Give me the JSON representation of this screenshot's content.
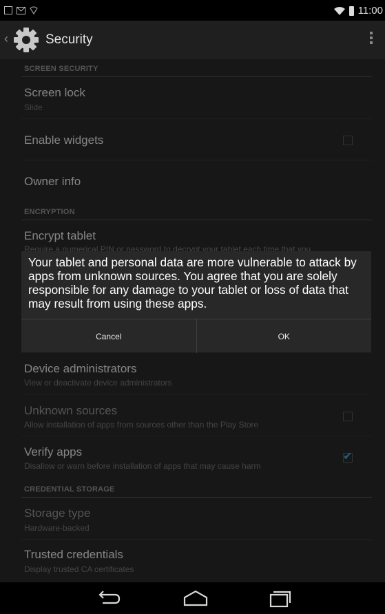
{
  "status_bar": {
    "time": "11:00",
    "icons": [
      "screenshot-icon",
      "gmail-icon",
      "notification-icon",
      "wifi-icon",
      "battery-icon"
    ]
  },
  "action_bar": {
    "title": "Security",
    "icon": "gear-icon"
  },
  "sections": {
    "screen_security": "SCREEN SECURITY",
    "encryption": "ENCRYPTION",
    "credential_storage": "CREDENTIAL STORAGE"
  },
  "items": {
    "screen_lock": {
      "title": "Screen lock",
      "summary": "Slide"
    },
    "enable_widgets": {
      "title": "Enable widgets",
      "checked": false
    },
    "owner_info": {
      "title": "Owner info"
    },
    "encrypt_tablet": {
      "title": "Encrypt tablet",
      "summary": "Require a numerical PIN or password to decrypt your tablet each time that you"
    },
    "device_admins": {
      "title": "Device administrators",
      "summary": "View or deactivate device administrators"
    },
    "unknown_sources": {
      "title": "Unknown sources",
      "summary": "Allow installation of apps from sources other than the Play Store",
      "checked": false
    },
    "verify_apps": {
      "title": "Verify apps",
      "summary": "Disallow or warn before installation of apps that may cause harm",
      "checked": true
    },
    "storage_type": {
      "title": "Storage type",
      "summary": "Hardware-backed"
    },
    "trusted_credentials": {
      "title": "Trusted credentials",
      "summary": "Display trusted CA certificates"
    }
  },
  "dialog": {
    "message": "Your tablet and personal data are more vulnerable to attack by apps from unknown sources. You agree that you are solely responsible for any damage to your tablet or loss of data that may result from using these apps.",
    "cancel_label": "Cancel",
    "ok_label": "OK"
  },
  "nav_bar": {
    "buttons": [
      "back-icon",
      "home-icon",
      "recents-icon"
    ]
  },
  "colors": {
    "accent": "#33b5e5",
    "list_background": "#2b2b2b",
    "action_bar": "#1f1f1f"
  }
}
